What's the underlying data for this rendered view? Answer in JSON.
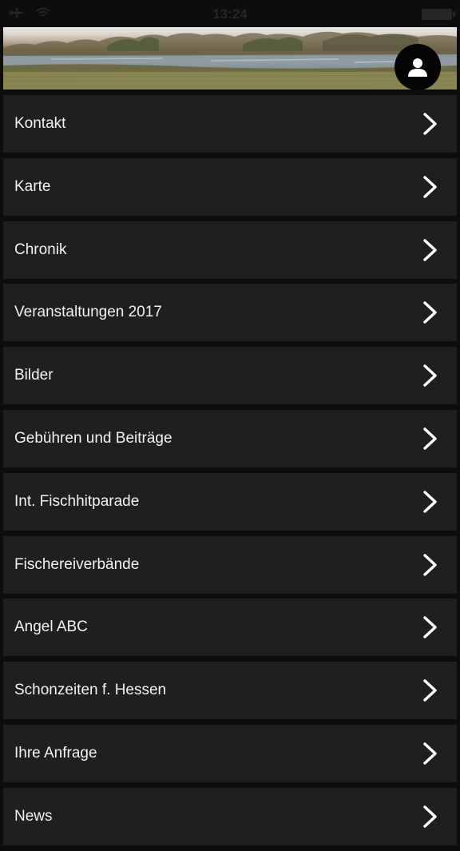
{
  "status_bar": {
    "time": "13:24",
    "icons": [
      "airplane-icon",
      "wifi-icon",
      "battery-icon"
    ]
  },
  "header": {
    "banner_image": "landscape-lake-photo",
    "profile_icon": "person-icon"
  },
  "menu": {
    "items": [
      {
        "label": "Kontakt",
        "icon": "chevron-right-icon"
      },
      {
        "label": "Karte",
        "icon": "chevron-right-icon"
      },
      {
        "label": "Chronik",
        "icon": "chevron-right-icon"
      },
      {
        "label": "Veranstaltungen 2017",
        "icon": "chevron-right-icon"
      },
      {
        "label": "Bilder",
        "icon": "chevron-right-icon"
      },
      {
        "label": "Gebühren und Beiträge",
        "icon": "chevron-right-icon"
      },
      {
        "label": "Int. Fischhitparade",
        "icon": "chevron-right-icon"
      },
      {
        "label": "Fischereiverbände",
        "icon": "chevron-right-icon"
      },
      {
        "label": "Angel ABC",
        "icon": "chevron-right-icon"
      },
      {
        "label": "Schonzeiten f. Hessen",
        "icon": "chevron-right-icon"
      },
      {
        "label": "Ihre Anfrage",
        "icon": "chevron-right-icon"
      },
      {
        "label": "News",
        "icon": "chevron-right-icon"
      }
    ]
  },
  "colors": {
    "background": "#0d0d0d",
    "item_background": "#1f1f1f",
    "text": "#f2f2f2",
    "chevron": "#ffffff"
  }
}
